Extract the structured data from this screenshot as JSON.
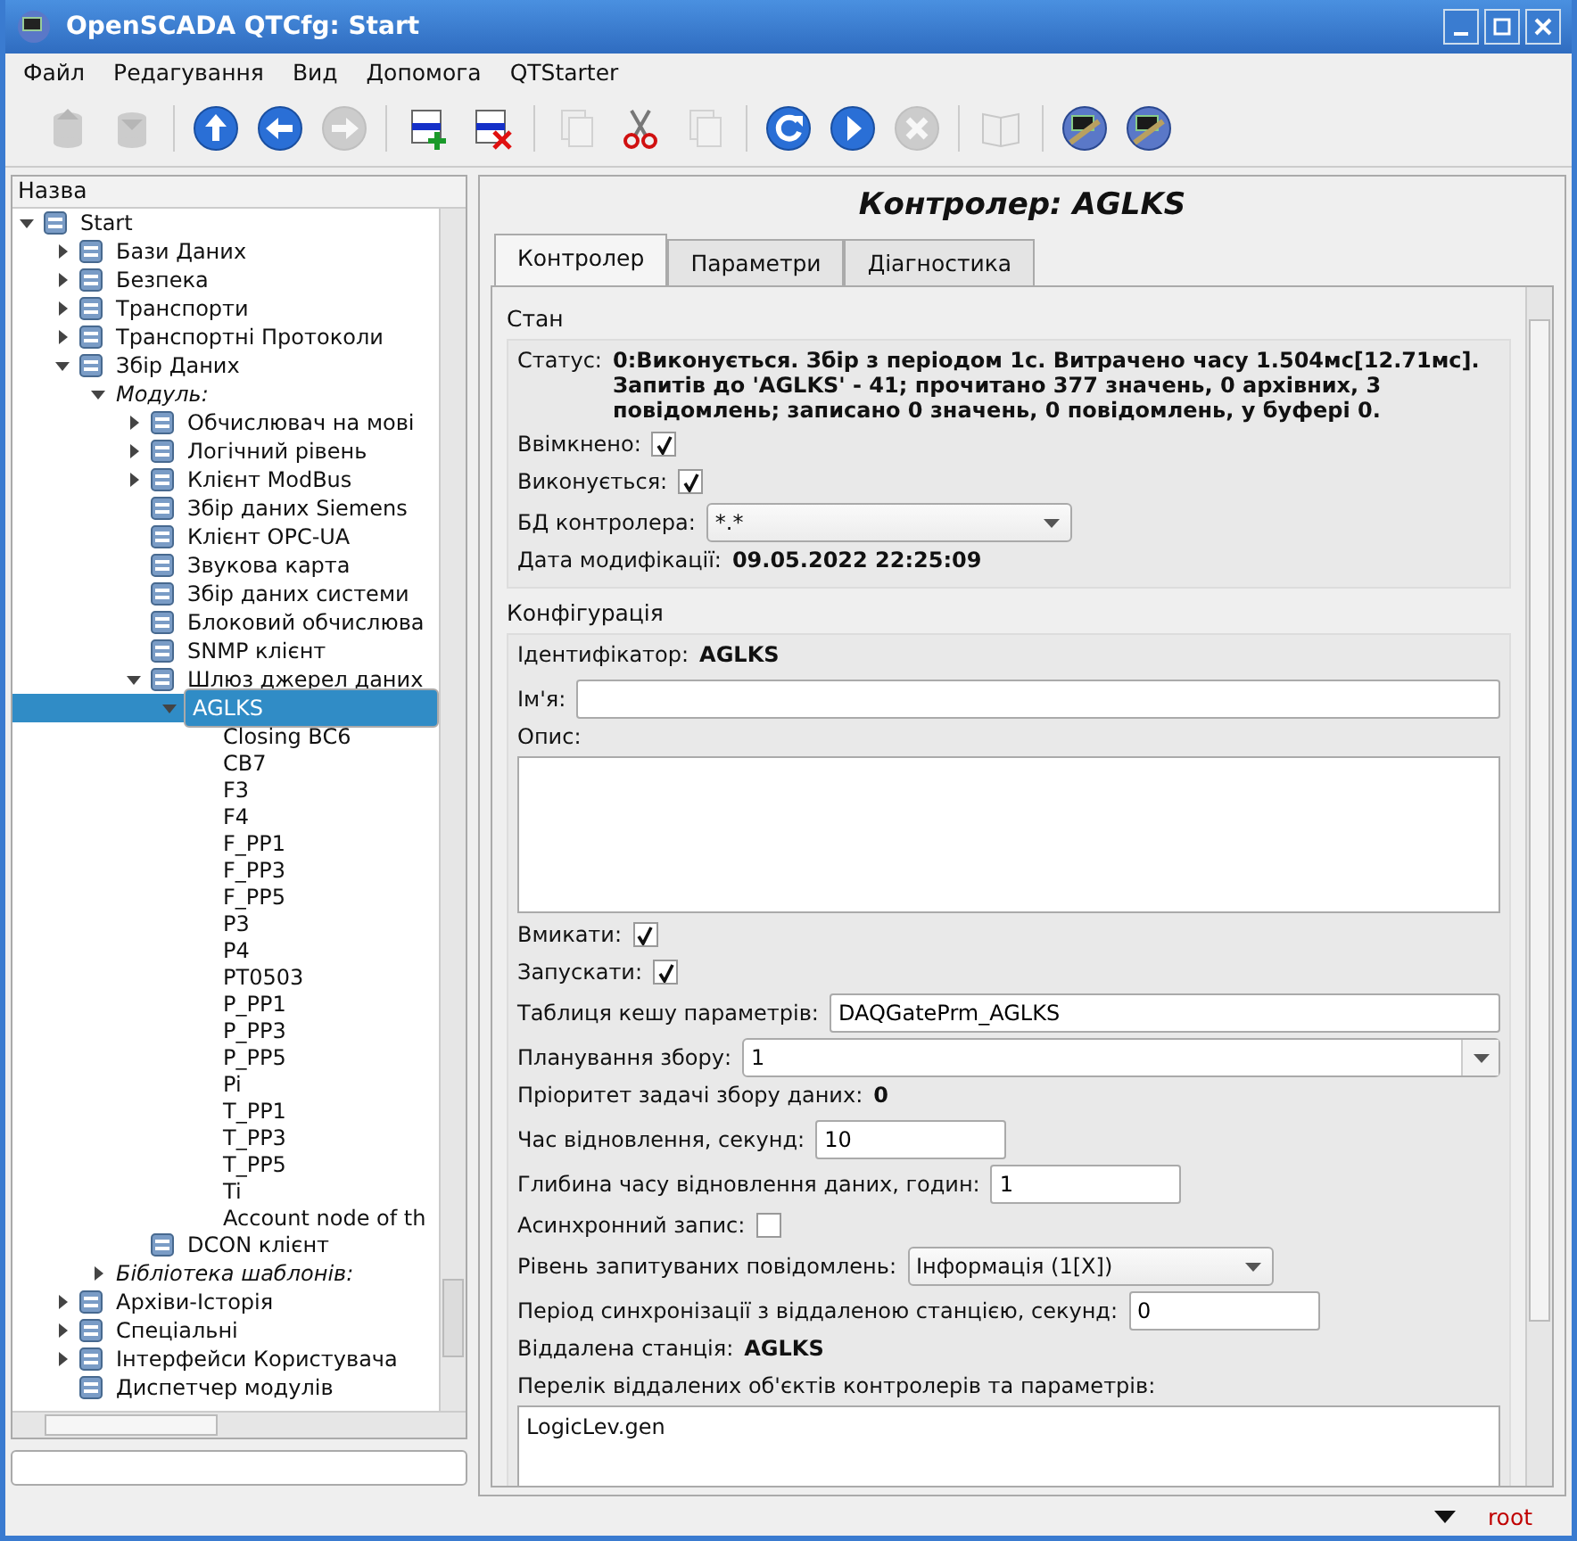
{
  "window": {
    "title": "OpenSCADA QTCfg: Start"
  },
  "menu": [
    "Файл",
    "Редагування",
    "Вид",
    "Допомога",
    "QTStarter"
  ],
  "toolbar": [
    {
      "kind": "db-load",
      "disabled": true
    },
    {
      "kind": "db-save",
      "disabled": true
    },
    {
      "kind": "up",
      "disabled": false
    },
    {
      "kind": "back",
      "disabled": false
    },
    {
      "kind": "forward",
      "disabled": true
    },
    {
      "kind": "add",
      "disabled": false
    },
    {
      "kind": "delete",
      "disabled": false
    },
    {
      "kind": "copy",
      "disabled": true
    },
    {
      "kind": "cut",
      "disabled": false
    },
    {
      "kind": "paste",
      "disabled": true
    },
    {
      "kind": "refresh",
      "disabled": false
    },
    {
      "kind": "start",
      "disabled": false
    },
    {
      "kind": "stop",
      "disabled": true
    },
    {
      "kind": "manual",
      "disabled": true
    },
    {
      "kind": "app",
      "disabled": false
    },
    {
      "kind": "app",
      "disabled": false
    }
  ],
  "tree": {
    "header": "Назва",
    "items": [
      {
        "label": "Start",
        "kind": "module",
        "expanded": true,
        "selected": false,
        "children": [
          {
            "label": "Бази Даних",
            "kind": "module",
            "expanded": false,
            "selected": false
          },
          {
            "label": "Безпека",
            "kind": "module",
            "expanded": false,
            "selected": false
          },
          {
            "label": "Транспорти",
            "kind": "module",
            "expanded": false,
            "selected": false
          },
          {
            "label": "Транспортні Протоколи",
            "kind": "module",
            "expanded": false,
            "selected": false
          },
          {
            "label": "Збір Даних",
            "kind": "module",
            "expanded": true,
            "selected": false,
            "children": [
              {
                "label": "Модуль:",
                "kind": "group",
                "expanded": true,
                "selected": false,
                "children": [
                  {
                    "label": "Обчислювач на мові",
                    "kind": "module",
                    "expanded": false,
                    "selected": false
                  },
                  {
                    "label": "Логічний рівень",
                    "kind": "module",
                    "expanded": false,
                    "selected": false
                  },
                  {
                    "label": "Клієнт ModBus",
                    "kind": "module",
                    "expanded": false,
                    "selected": false
                  },
                  {
                    "label": "Збір даних Siemens",
                    "kind": "module",
                    "selected": false
                  },
                  {
                    "label": "Клієнт OPC-UA",
                    "kind": "module",
                    "selected": false
                  },
                  {
                    "label": "Звукова карта",
                    "kind": "module",
                    "selected": false
                  },
                  {
                    "label": "Збір даних системи",
                    "kind": "module",
                    "selected": false
                  },
                  {
                    "label": "Блоковий обчислюва",
                    "kind": "module",
                    "selected": false
                  },
                  {
                    "label": "SNMP клієнт",
                    "kind": "module",
                    "selected": false
                  },
                  {
                    "label": "Шлюз джерел даних",
                    "kind": "module",
                    "expanded": true,
                    "selected": false,
                    "children": [
                      {
                        "label": "AGLKS",
                        "expanded": true,
                        "selected": true,
                        "children": [
                          {
                            "label": "Closing BC6",
                            "kind": "param",
                            "selected": false
                          },
                          {
                            "label": "CB7",
                            "kind": "param",
                            "selected": false
                          },
                          {
                            "label": "F3",
                            "kind": "param",
                            "selected": false
                          },
                          {
                            "label": "F4",
                            "kind": "param",
                            "selected": false
                          },
                          {
                            "label": "F_PP1",
                            "kind": "param",
                            "selected": false
                          },
                          {
                            "label": "F_PP3",
                            "kind": "param",
                            "selected": false
                          },
                          {
                            "label": "F_PP5",
                            "kind": "param",
                            "selected": false
                          },
                          {
                            "label": "P3",
                            "kind": "param",
                            "selected": false
                          },
                          {
                            "label": "P4",
                            "kind": "param",
                            "selected": false
                          },
                          {
                            "label": "PT0503",
                            "kind": "param",
                            "selected": false
                          },
                          {
                            "label": "P_PP1",
                            "kind": "param",
                            "selected": false
                          },
                          {
                            "label": "P_PP3",
                            "kind": "param",
                            "selected": false
                          },
                          {
                            "label": "P_PP5",
                            "kind": "param",
                            "selected": false
                          },
                          {
                            "label": "Pi",
                            "kind": "param",
                            "selected": false
                          },
                          {
                            "label": "T_PP1",
                            "kind": "param",
                            "selected": false
                          },
                          {
                            "label": "T_PP3",
                            "kind": "param",
                            "selected": false
                          },
                          {
                            "label": "T_PP5",
                            "kind": "param",
                            "selected": false
                          },
                          {
                            "label": "Ti",
                            "kind": "param",
                            "selected": false
                          },
                          {
                            "label": "Account node of th",
                            "kind": "param",
                            "selected": false
                          }
                        ]
                      }
                    ]
                  },
                  {
                    "label": "DCON клієнт",
                    "kind": "module",
                    "selected": false
                  }
                ]
              },
              {
                "label": "Бібліотека шаблонів:",
                "kind": "group",
                "expanded": false,
                "selected": false
              }
            ]
          },
          {
            "label": "Архіви-Історія",
            "kind": "module",
            "expanded": false,
            "selected": false
          },
          {
            "label": "Спеціальні",
            "kind": "module",
            "expanded": false,
            "selected": false
          },
          {
            "label": "Інтерфейси Користувача",
            "kind": "module",
            "expanded": false,
            "selected": false
          },
          {
            "label": "Диспетчер модулів",
            "kind": "module",
            "selected": false
          }
        ]
      }
    ]
  },
  "page": {
    "title": "Контролер: AGLKS",
    "tabs": [
      {
        "label": "Контролер",
        "selected": true
      },
      {
        "label": "Параметри",
        "selected": false
      },
      {
        "label": "Діагностика",
        "selected": false
      }
    ],
    "sections": [
      {
        "title": "Стан",
        "fields": [
          {
            "kind": "info",
            "label": "Статус:",
            "value": "0:Виконується. Збір з періодом 1с. Витрачено часу 1.504мс[12.71мс]. Запитів до 'AGLKS' - 41; прочитано 377 значень, 0 архівних, 3 повідомлень; записано 0 значень, 0 повідомлень, у буфері 0."
          },
          {
            "kind": "checkbox",
            "label": "Ввімкнено:",
            "checked": true
          },
          {
            "kind": "checkbox",
            "label": "Виконується:",
            "checked": true
          },
          {
            "kind": "select",
            "label": "БД контролера:",
            "value": "*.*"
          },
          {
            "kind": "info",
            "label": "Дата модифікації:",
            "value": "09.05.2022 22:25:09"
          }
        ]
      },
      {
        "title": "Конфігурація",
        "fields": [
          {
            "kind": "info",
            "label": "Ідентифікатор:",
            "value": "AGLKS"
          },
          {
            "kind": "line",
            "label": "Ім'я:"
          },
          {
            "kind": "textarea",
            "label": "Опис:"
          },
          {
            "kind": "checkbox",
            "label": "Вмикати:",
            "checked": true
          },
          {
            "kind": "checkbox",
            "label": "Запускати:",
            "checked": true
          },
          {
            "kind": "line",
            "label": "Таблиця кешу параметрів:",
            "value": "DAQGatePrm_AGLKS"
          },
          {
            "kind": "combo",
            "label": "Планування збору:",
            "value": "1"
          },
          {
            "kind": "info",
            "label": "Пріоритет задачі збору даних:",
            "value": "0"
          },
          {
            "kind": "number",
            "label": "Час відновлення, секунд:",
            "value": "10"
          },
          {
            "kind": "number",
            "label": "Глибина часу відновлення даних, годин:",
            "value": "1"
          },
          {
            "kind": "checkbox",
            "label": "Асинхронний запис:",
            "checked": false
          },
          {
            "kind": "select",
            "label": "Рівень запитуваних повідомлень:",
            "value": "Інформація (1[X])"
          },
          {
            "kind": "number",
            "label": "Період синхронізації з віддаленою станцією, секунд:",
            "value": "0"
          },
          {
            "kind": "info",
            "label": "Віддалена станція:",
            "value": "AGLKS"
          },
          {
            "kind": "textarea",
            "label": "Перелік віддалених об'єктів контролерів та параметрів:",
            "value": "LogicLev.gen"
          }
        ]
      }
    ]
  },
  "status_bar": {
    "user": "root"
  }
}
